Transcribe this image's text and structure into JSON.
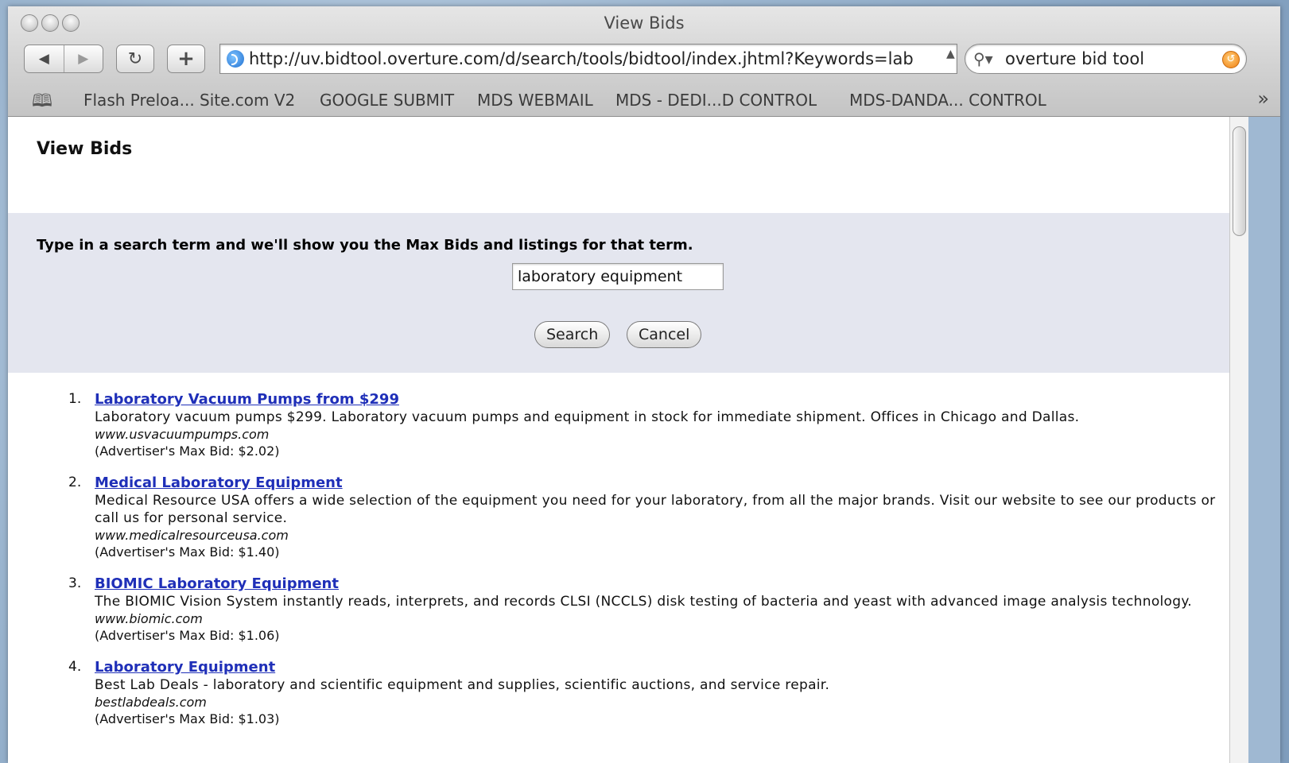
{
  "window": {
    "title": "View Bids"
  },
  "toolbar": {
    "back_icon": "back-arrow-icon",
    "forward_icon": "forward-arrow-icon",
    "reload_icon": "reload-icon",
    "add_bookmark_icon": "plus-icon",
    "url": "http://uv.bidtool.overture.com/d/search/tools/bidtool/index.jhtml?Keywords=lab",
    "search_value": "overture bid tool"
  },
  "bookmarks": [
    "Flash Preloa... Site.com V2",
    "GOOGLE SUBMIT",
    "MDS WEBMAIL",
    "MDS - DEDI...D CONTROL",
    "MDS-DANDA... CONTROL"
  ],
  "page": {
    "title": "View Bids",
    "prompt": "Type in a search term and we'll show you the Max Bids and listings for that term.",
    "term_value": "laboratory equipment",
    "search_label": "Search",
    "cancel_label": "Cancel"
  },
  "results": [
    {
      "num": "1.",
      "title": "Laboratory Vacuum Pumps from $299",
      "desc": "Laboratory vacuum pumps $299. Laboratory vacuum pumps and equipment in stock for immediate shipment. Offices in Chicago and Dallas.",
      "url": "www.usvacuumpumps.com",
      "bid": "(Advertiser's Max Bid: $2.02)"
    },
    {
      "num": "2.",
      "title": "Medical Laboratory Equipment",
      "desc": "Medical Resource USA offers a wide selection of the equipment you need for your laboratory, from all the major brands. Visit our website to see our products or call us for personal service.",
      "url": "www.medicalresourceusa.com",
      "bid": "(Advertiser's Max Bid: $1.40)"
    },
    {
      "num": "3.",
      "title": "BIOMIC Laboratory Equipment",
      "desc": "The BIOMIC Vision System instantly reads, interprets, and records CLSI (NCCLS) disk testing of bacteria and yeast with advanced image analysis technology.",
      "url": "www.biomic.com",
      "bid": "(Advertiser's Max Bid: $1.06)"
    },
    {
      "num": "4.",
      "title": "Laboratory Equipment",
      "desc": "Best Lab Deals - laboratory and scientific equipment and supplies, scientific auctions, and service repair.",
      "url": "bestlabdeals.com",
      "bid": "(Advertiser's Max Bid: $1.03)"
    }
  ]
}
